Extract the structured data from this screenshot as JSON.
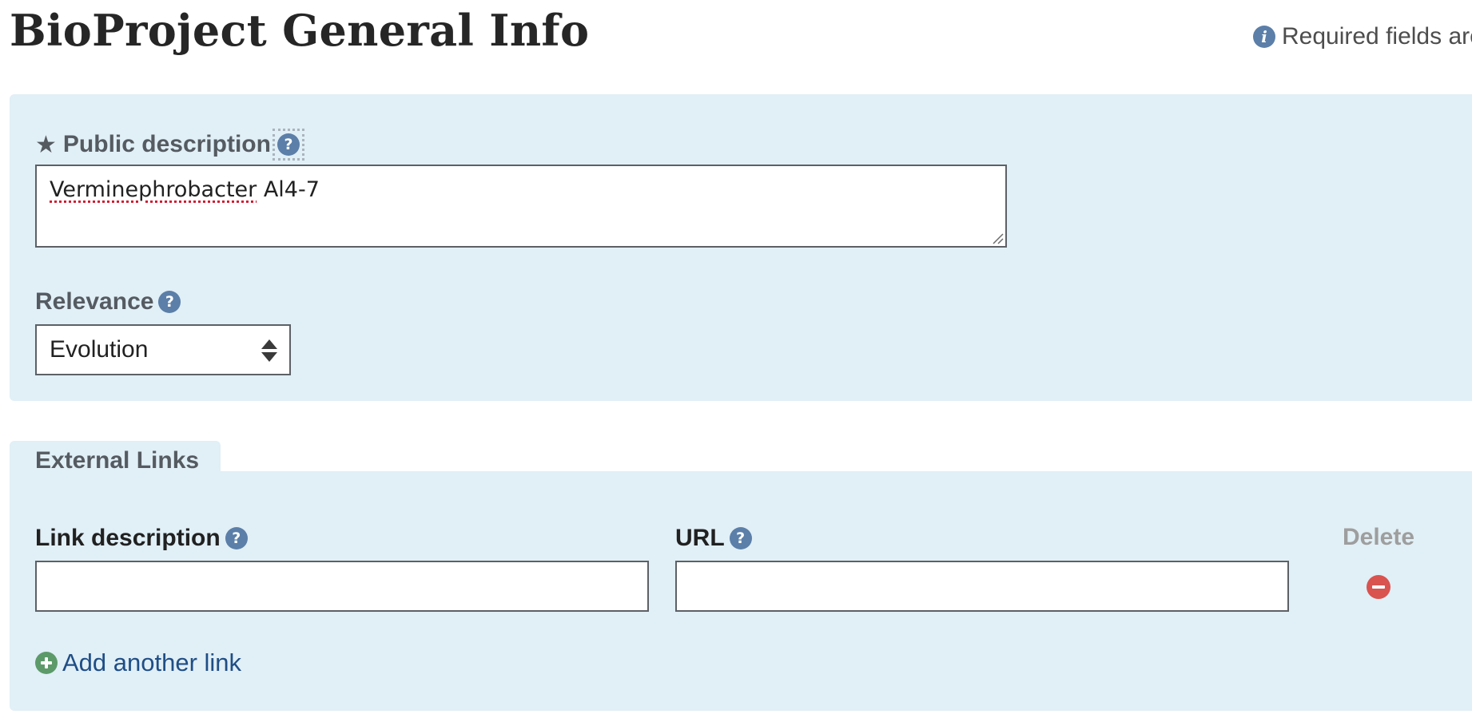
{
  "page": {
    "title": "BioProject General Info",
    "required_note": "Required fields are"
  },
  "general": {
    "public_description": {
      "required_marker": "★",
      "label": "Public description",
      "value_misspelled": "Verminephrobacter",
      "value_rest": " Al4-7"
    },
    "relevance": {
      "label": "Relevance",
      "selected": "Evolution"
    }
  },
  "external_links": {
    "tab_label": "External Links",
    "link_description_label": "Link description",
    "url_label": "URL",
    "delete_label": "Delete",
    "link_description_value": "",
    "url_value": "",
    "add_link_label": "Add another link"
  },
  "icons": {
    "info": "i",
    "help": "?"
  },
  "colors": {
    "panel_bg": "#e1eff6",
    "help_icon": "#5b7fa8",
    "link_text": "#1f4e86",
    "add_icon": "#5c9a6a",
    "delete_icon": "#d9534f",
    "delete_label": "#9e9e9e"
  }
}
